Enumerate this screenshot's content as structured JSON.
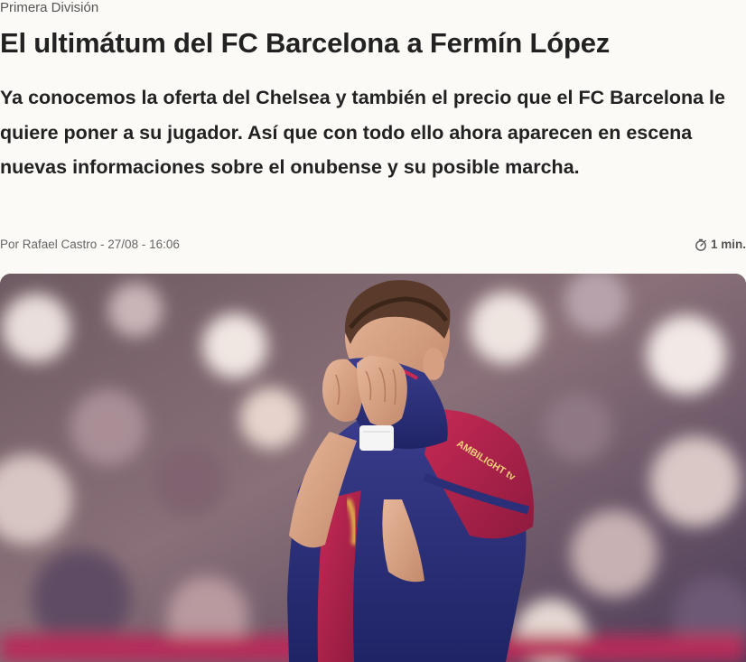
{
  "article": {
    "category": "Primera División",
    "headline": "El ultimátum del FC Barcelona a Fermín López",
    "lede": "Ya conocemos la oferta del Chelsea y también el precio que el FC Barcelona le quiere poner a su jugador. Así que con todo ello ahora aparecen en escena nuevas informaciones sobre el onubense y su posible marcha.",
    "byline": "Por Rafael Castro - 27/08 - 16:06",
    "reading_time": "1 min.",
    "reading_time_icon": "stopwatch-icon"
  },
  "hero_image": {
    "description_icon": "player-photo",
    "shirt_sponsor": "AMBILIGHT tv"
  },
  "colors": {
    "background": "#fcfaf7",
    "text": "#222222",
    "muted": "#666666",
    "shirt_blue": "#2a2f7a",
    "shirt_red": "#b2214a"
  }
}
